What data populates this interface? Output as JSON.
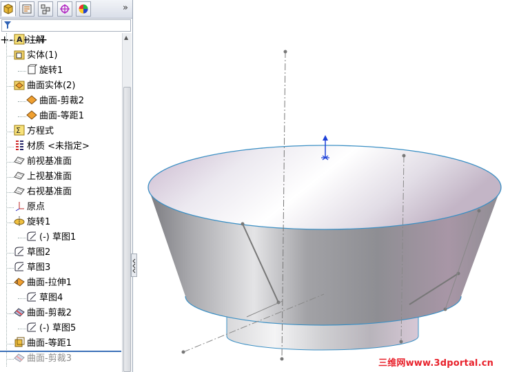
{
  "panel": {
    "tabs": [
      "feature-manager-icon",
      "property-manager-icon",
      "configuration-manager-icon",
      "dimxpert-icon",
      "display-manager-icon"
    ],
    "collapse_glyph": "»"
  },
  "tree": {
    "items": [
      {
        "label": "注解",
        "icon": "annotation-icon"
      },
      {
        "label": "实体(1)",
        "icon": "solid-body-folder-icon"
      },
      {
        "label": "旋转1",
        "icon": "body-icon"
      },
      {
        "label": "曲面实体(2)",
        "icon": "surface-body-folder-icon"
      },
      {
        "label": "曲面-剪裁2",
        "icon": "surface-icon"
      },
      {
        "label": "曲面-等距1",
        "icon": "surface-icon"
      },
      {
        "label": "方程式",
        "icon": "equation-icon"
      },
      {
        "label": "材质 <未指定>",
        "icon": "material-icon"
      },
      {
        "label": "前视基准面",
        "icon": "plane-icon"
      },
      {
        "label": "上视基准面",
        "icon": "plane-icon"
      },
      {
        "label": "右视基准面",
        "icon": "plane-icon"
      },
      {
        "label": "原点",
        "icon": "origin-icon"
      },
      {
        "label": "旋转1",
        "icon": "revolve-icon"
      },
      {
        "label": "(-) 草图1",
        "icon": "sketch-icon"
      },
      {
        "label": "草图2",
        "icon": "sketch-icon"
      },
      {
        "label": "草图3",
        "icon": "sketch-icon"
      },
      {
        "label": "曲面-拉伸1",
        "icon": "surface-extrude-icon"
      },
      {
        "label": "草图4",
        "icon": "sketch-icon"
      },
      {
        "label": "曲面-剪裁2",
        "icon": "surface-trim-icon"
      },
      {
        "label": "(-) 草图5",
        "icon": "sketch-icon"
      },
      {
        "label": "曲面-等距1",
        "icon": "surface-offset-icon"
      },
      {
        "label": "曲面-剪裁3",
        "icon": "surface-trim-icon"
      }
    ]
  },
  "watermark": "三维网www.3dportal.cn",
  "colors": {
    "edge": "#3a8fc4",
    "accent": "#e8202a",
    "selection_bar": "#3a6fb7"
  }
}
